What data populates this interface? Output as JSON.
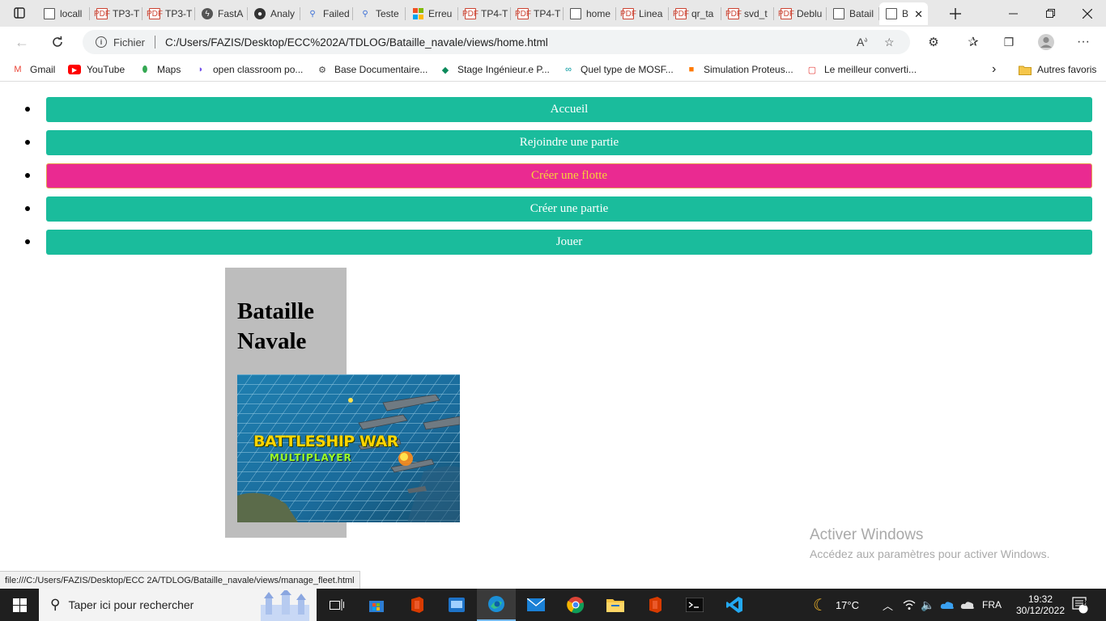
{
  "browser": {
    "tabs": [
      {
        "label": "locall",
        "icon": "file-icon"
      },
      {
        "label": "TP3-T",
        "icon": "pdf-icon"
      },
      {
        "label": "TP3-T",
        "icon": "pdf-icon"
      },
      {
        "label": "FastA",
        "icon": "fastapi-icon"
      },
      {
        "label": "Analy",
        "icon": "github-icon"
      },
      {
        "label": "Failed",
        "icon": "search-icon"
      },
      {
        "label": "Teste",
        "icon": "search-icon"
      },
      {
        "label": "Erreu",
        "icon": "windows-icon"
      },
      {
        "label": "TP4-T",
        "icon": "pdf-icon"
      },
      {
        "label": "TP4-T",
        "icon": "pdf-icon"
      },
      {
        "label": "home",
        "icon": "file-icon"
      },
      {
        "label": "Linea",
        "icon": "pdf-icon"
      },
      {
        "label": "qr_ta",
        "icon": "pdf-icon"
      },
      {
        "label": "svd_t",
        "icon": "pdf-icon"
      },
      {
        "label": "Deblu",
        "icon": "pdf-icon"
      },
      {
        "label": "Batail",
        "icon": "file-icon"
      }
    ],
    "active_tab": {
      "label": "B"
    },
    "address": {
      "site_label": "Fichier",
      "url": "C:/Users/FAZIS/Desktop/ECC%202A/TDLOG/Bataille_navale/views/home.html"
    },
    "bookmarks": [
      {
        "label": "Gmail",
        "icon": "gmail-icon",
        "color": "#ea4335"
      },
      {
        "label": "YouTube",
        "icon": "youtube-icon",
        "color": "#ff0000"
      },
      {
        "label": "Maps",
        "icon": "maps-icon",
        "color": "#34a853"
      },
      {
        "label": "open classroom po...",
        "icon": "openclassrooms-icon",
        "color": "#7451eb"
      },
      {
        "label": "Base Documentaire...",
        "icon": "gear-icon",
        "color": "#444"
      },
      {
        "label": "Stage Ingénieur.e P...",
        "icon": "location-icon",
        "color": "#0b8a5b"
      },
      {
        "label": "Quel type de MOSF...",
        "icon": "arduino-icon",
        "color": "#00979d"
      },
      {
        "label": "Simulation Proteus...",
        "icon": "orange-icon",
        "color": "#ff7900"
      },
      {
        "label": "Le meilleur converti...",
        "icon": "converter-icon",
        "color": "#e53935"
      }
    ],
    "other_favorites": "Autres favoris"
  },
  "page": {
    "menu": [
      {
        "label": "Accueil",
        "state": "normal"
      },
      {
        "label": "Rejoindre une partie",
        "state": "normal"
      },
      {
        "label": "Créer une flotte",
        "state": "hover"
      },
      {
        "label": "Créer une partie",
        "state": "normal"
      },
      {
        "label": "Jouer",
        "state": "normal"
      }
    ],
    "colors": {
      "button": "#1abc9c",
      "button_hover": "#ea2a91",
      "hover_text": "#f6d23a"
    },
    "hero": {
      "title_line1": "Bataille",
      "title_line2": "Navale",
      "image_logo": "BATTLESHIP WAR",
      "image_sub": "MULTIPLAYER"
    },
    "status_url": "file:///C:/Users/FAZIS/Desktop/ECC 2A/TDLOG/Bataille_navale/views/manage_fleet.html",
    "watermark": {
      "title": "Activer Windows",
      "subtitle": "Accédez aux paramètres pour activer Windows."
    }
  },
  "taskbar": {
    "search_placeholder": "Taper ici pour rechercher",
    "weather": "17°C",
    "language": "FRA",
    "time": "19:32",
    "date": "30/12/2022",
    "notifications": "8"
  }
}
